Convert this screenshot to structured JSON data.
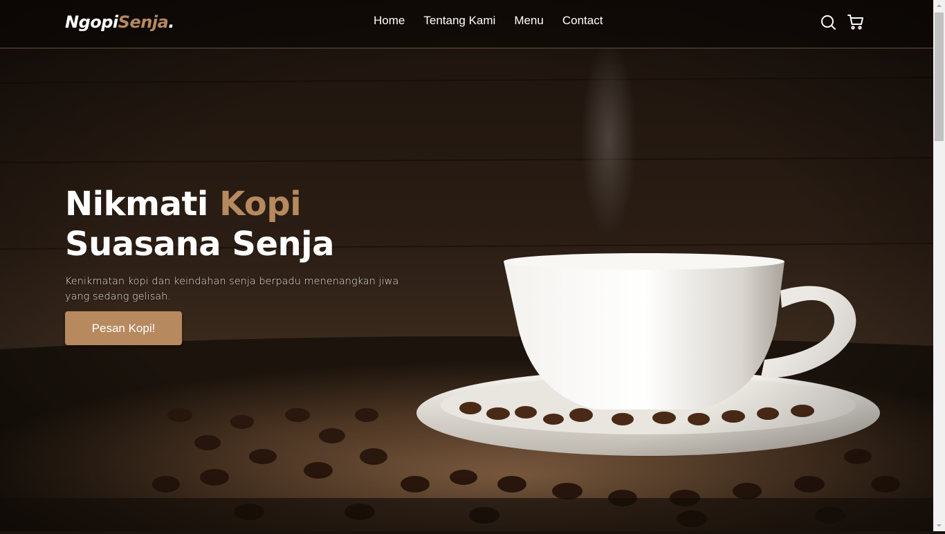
{
  "brand": {
    "name_main": "Ngopi",
    "name_accent": "Senja",
    "name_dot": "."
  },
  "nav": {
    "items": [
      {
        "label": "Home"
      },
      {
        "label": "Tentang Kami"
      },
      {
        "label": "Menu"
      },
      {
        "label": "Contact"
      }
    ],
    "icons": [
      "search-icon",
      "shopping-cart-icon"
    ]
  },
  "hero": {
    "title_line1_plain": "Nikmati ",
    "title_line1_accent": "Kopi",
    "title_line2": "Suasana Senja",
    "description": "Kenikmatan kopi dan keindahan senja berpadu menenangkan jiwa yang sedang gelisah.",
    "cta_label": "Pesan Kopi!"
  },
  "colors": {
    "accent": "#b6895f",
    "nav_border": "#b6895f",
    "text": "#ffffff"
  }
}
